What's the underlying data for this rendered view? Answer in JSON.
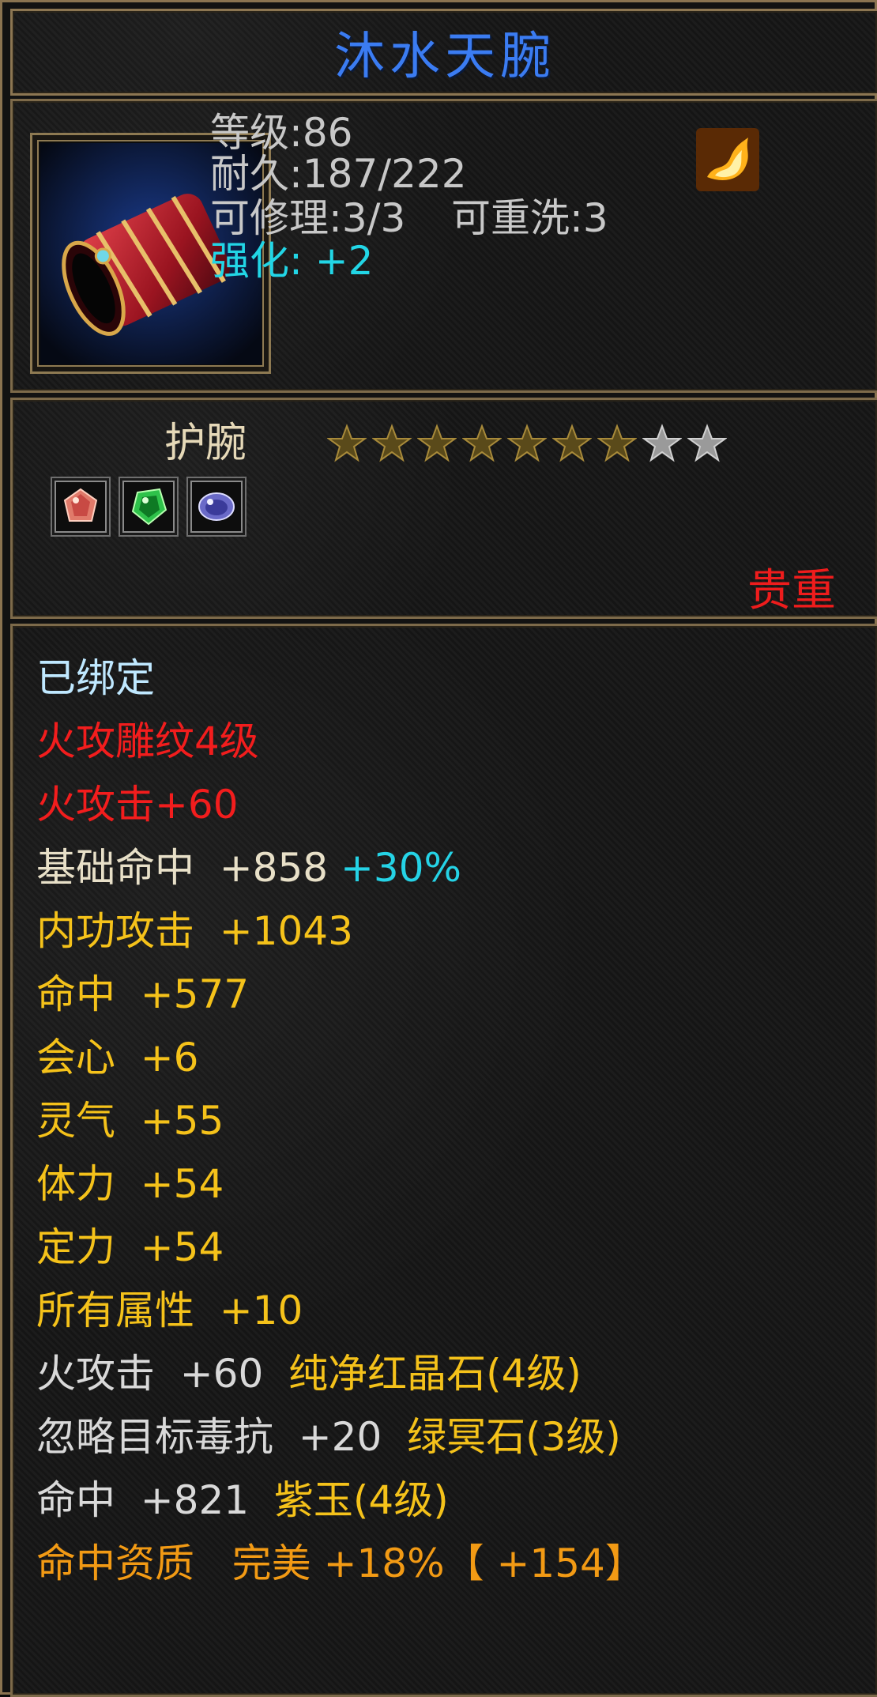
{
  "title": "沐水天腕",
  "item": {
    "icon": "red-bracer-icon",
    "level_label": "等级:86",
    "durability_label": "耐久:187/222",
    "repair_label": "可修理:3/3",
    "rewash_label": "可重洗:3",
    "enhance_label": "强化: +2",
    "element_icon": "fire-element-icon"
  },
  "type": {
    "label": "护腕",
    "stars_filled": 7,
    "stars_total": 9,
    "gems": [
      "red-gem-icon",
      "green-gem-icon",
      "purple-gem-icon"
    ],
    "rarity": "贵重"
  },
  "attributes": {
    "bound": "已绑定",
    "engrave": "火攻雕纹4级",
    "fire_attack": "火攻击+60",
    "base_hit": "基础命中  +858",
    "base_hit_pct": "+30%",
    "inner_attack": "内功攻击  +1043",
    "hit": "命中  +577",
    "crit": "会心  +6",
    "spirit": "灵气  +55",
    "stamina": "体力  +54",
    "focus": "定力  +54",
    "all_attr": "所有属性  +10",
    "gem1_stat": "火攻击  +60",
    "gem1_name": "纯净红晶石(4级)",
    "gem2_stat": "忽略目标毒抗  +20",
    "gem2_name": "绿冥石(3级)",
    "gem3_stat": "命中  +821",
    "gem3_name": "紫玉(4级)",
    "aptitude": "命中资质   完美 +18%【 +154】"
  },
  "colors": {
    "title": "#3b7cf2",
    "border": "#8a7350",
    "rarity": "#ee1c1c",
    "attr_yellow": "#f5c21a",
    "attr_red": "#f21d1d",
    "cyan": "#25d3e6",
    "orange": "#f29a14"
  }
}
